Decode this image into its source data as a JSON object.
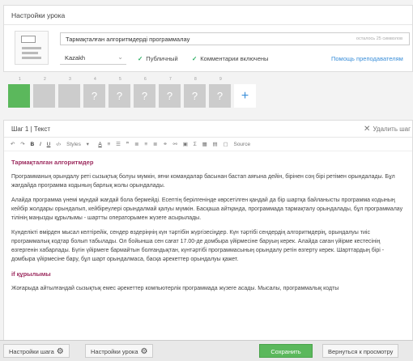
{
  "lesson": {
    "header": "Настройки урока",
    "title_value": "Тармақталған алгоритмдерді программалау",
    "char_count": "осталось 25 символов",
    "language": "Kazakh",
    "public_label": "Публичный",
    "comments_label": "Комментарии включены",
    "help_link": "Помощь преподавателям"
  },
  "steps": {
    "numbers": [
      "1",
      "2",
      "3",
      "4",
      "5",
      "6",
      "7",
      "8",
      "9"
    ],
    "unknown_glyph": "?",
    "add_glyph": "+"
  },
  "editor": {
    "header": "Шаг 1 | Текст",
    "delete_label": "Удалить шаг",
    "toolbar": {
      "undo": "↶",
      "redo": "↷",
      "bold": "B",
      "italic": "I",
      "underline": "U",
      "code": "‹/›",
      "styles": "Styles",
      "font_color": "A",
      "source": "Source"
    },
    "content": {
      "heading1": "Тармақталған алгоритмдер",
      "p1": "Программаның орындалу реті сызықтық болуы мүмкін, яғни командалар басынан бастап аяғына дейін, бірінен соң бірі ретімен орындалады. Бұл жағдайда программа кодының барлық жолы орындалады.",
      "p2": "Алайда программа үнемі мұндай жағдай бола бермейді. Есептің берілгенінде көрсетілген қандай да бір шартқа байланысты программа кодының кейбір жолдары орындалып, кейбіреулері орындалмай қалуы мүмкін. Басқаша айтқанда, программада тармақталу орындалады, бұл программалау тілінің маңызды құрылымы - шартты операторымен жүзеге асырылады.",
      "p3": "Күнделікті өмірден мысал келтірейік, сендер өздеріңнің күн тәртібін жүргізесіңдер. Күн тәртібі сендердің алгоритмдерің, орындалуы тиіс программалық кодтар болып табылады. Ол бойынша сен сағат 17.00-де домбыра үйірмесіне баруың керек. Алайда саған үйірме кестесінің өзгергенін хабарлады. Бүгін үйірмеге бармайтын болғандықтан, күнтәртібі программасының орындалу ретін өзгерту керек. Шарттардың бірі - домбыра үйірмесіне бару, бұл шарт орындалмаса, басқа әрекеттер орындалуы қажет.",
      "heading2": "if құрылымы",
      "p4": "Жоғарыда айтылғандай сызықтық емес әрекеттер компьютерлік программада жүзеге асады. Мысалы, программалық кодты"
    }
  },
  "bottom": {
    "step_settings": "Настройки шага",
    "lesson_settings": "Настройки урока",
    "save": "Сохранить",
    "back_to_view": "Вернуться к просмотру"
  },
  "colors": {
    "accent_green": "#5bb85c",
    "link_blue": "#3b8fd9",
    "heading_purple": "#9c2b5e"
  }
}
